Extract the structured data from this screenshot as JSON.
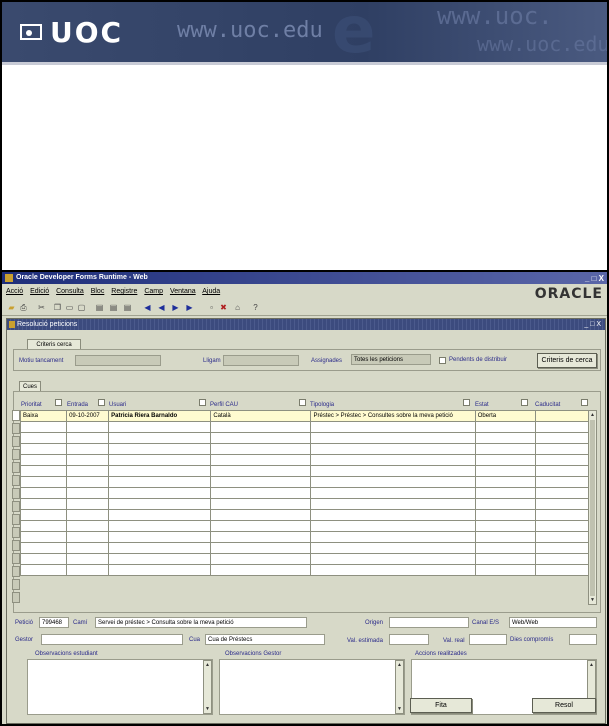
{
  "banner": {
    "logo_text": "UOC",
    "url_text": "www.uoc.edu",
    "watermark_1": "www.uoc.",
    "watermark_2": "www.uoc.edu",
    "watermark_big": "e"
  },
  "window": {
    "title": "Oracle Developer Forms Runtime - Web",
    "brand": "ORACLE",
    "controls": "_ □ X"
  },
  "menu": [
    "Acció",
    "Edició",
    "Consulta",
    "Bloc",
    "Registre",
    "Camp",
    "Ventana",
    "Ajuda"
  ],
  "form": {
    "title": "Resolució peticions",
    "controls": "_ □ X",
    "tab_criteria": "Criteris cerca",
    "tab_cues": "Cues",
    "motiu_label": "Motiu tancament",
    "lugar_label": "Lligam",
    "assignades_label": "Assignades",
    "assignades_value": "Totes les peticions",
    "pendents_label": "Pendents de distribuir",
    "criteria_button": "Criteris de cerca"
  },
  "table": {
    "columns": [
      "Prioritat",
      "Entrada",
      "Usuari",
      "Perfil CAU",
      "Tipologia",
      "Estat",
      "Caducitat"
    ],
    "rows": [
      [
        "Baixa",
        "09-10-2007",
        "Patricia Riera Barnaldo",
        "Català",
        "Préstec > Préstec > Consultes sobre la meva petició",
        "Oberta",
        ""
      ]
    ],
    "empty_rows": 14
  },
  "detail": {
    "peticio_label": "Petició",
    "peticio_value": "799468",
    "cami_label": "Camí",
    "cami_value": "Servei de préstec > Consulta sobre la meva petició",
    "origen_label": "Origen",
    "canal_label": "Canal E/S",
    "canal_value": "Web/Web",
    "gestor_label": "Gestor",
    "cua_label": "Cua",
    "cua_value": "Cua de Préstecs",
    "val_estimada_label": "Val. estimada",
    "val_real_label": "Val. real",
    "dies_label": "Dies compromís",
    "obs_estudiant_label": "Observacions estudiant",
    "obs_gestor_label": "Observacions Gestor",
    "accions_label": "Accions realitzades",
    "fita_button": "Fita",
    "resol_button": "Resol"
  },
  "colors": {
    "banner_bg": "#2f3f63",
    "form_bg": "#d7d9c8",
    "title_bar": "#1e2e7a",
    "selected_row": "#fffbd0"
  }
}
